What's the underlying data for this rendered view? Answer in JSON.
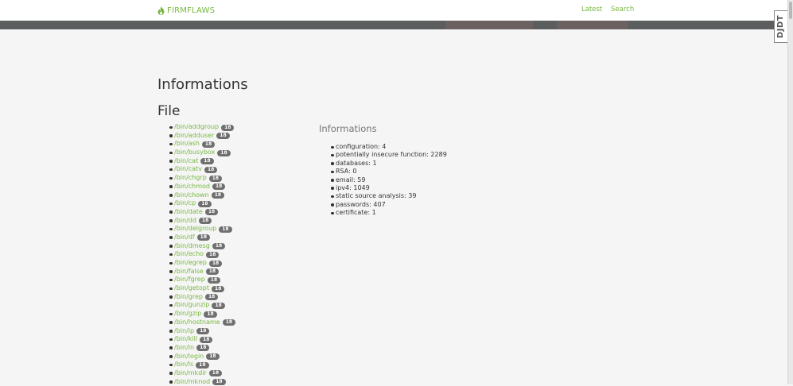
{
  "nav": {
    "brand": "FIRMFLAWS",
    "links": [
      "Latest",
      "Search"
    ]
  },
  "debug_toolbar": {
    "label": "DJDT"
  },
  "colors": {
    "accent": "#76b83f",
    "banner": "#5b5d5f",
    "badge": "#6f6f6f"
  },
  "page": {
    "title": "Informations"
  },
  "files": {
    "title": "File",
    "items": [
      {
        "path": "/bin/addgroup",
        "count": "18"
      },
      {
        "path": "/bin/adduser",
        "count": "18"
      },
      {
        "path": "/bin/ash",
        "count": "18"
      },
      {
        "path": "/bin/busybox",
        "count": "18"
      },
      {
        "path": "/bin/cat",
        "count": "18"
      },
      {
        "path": "/bin/catv",
        "count": "18"
      },
      {
        "path": "/bin/chgrp",
        "count": "18"
      },
      {
        "path": "/bin/chmod",
        "count": "18"
      },
      {
        "path": "/bin/chown",
        "count": "18"
      },
      {
        "path": "/bin/cp",
        "count": "18"
      },
      {
        "path": "/bin/date",
        "count": "18"
      },
      {
        "path": "/bin/dd",
        "count": "18"
      },
      {
        "path": "/bin/delgroup",
        "count": "18"
      },
      {
        "path": "/bin/df",
        "count": "18"
      },
      {
        "path": "/bin/dmesg",
        "count": "18"
      },
      {
        "path": "/bin/echo",
        "count": "18"
      },
      {
        "path": "/bin/egrep",
        "count": "18"
      },
      {
        "path": "/bin/false",
        "count": "18"
      },
      {
        "path": "/bin/fgrep",
        "count": "18"
      },
      {
        "path": "/bin/getopt",
        "count": "18"
      },
      {
        "path": "/bin/grep",
        "count": "18"
      },
      {
        "path": "/bin/gunzip",
        "count": "18"
      },
      {
        "path": "/bin/gzip",
        "count": "18"
      },
      {
        "path": "/bin/hostname",
        "count": "18"
      },
      {
        "path": "/bin/ip",
        "count": "18"
      },
      {
        "path": "/bin/kill",
        "count": "18"
      },
      {
        "path": "/bin/ln",
        "count": "18"
      },
      {
        "path": "/bin/login",
        "count": "18"
      },
      {
        "path": "/bin/ls",
        "count": "18"
      },
      {
        "path": "/bin/mkdir",
        "count": "18"
      },
      {
        "path": "/bin/mknod",
        "count": "18"
      }
    ]
  },
  "info": {
    "title": "Informations",
    "items": [
      "configuration: 4",
      "potentially insecure function: 2289",
      "databases: 1",
      "RSA: 0",
      "email: 59",
      "ipv4: 1049",
      "static source analysis: 39",
      "passwords: 407",
      "certificate: 1"
    ]
  }
}
